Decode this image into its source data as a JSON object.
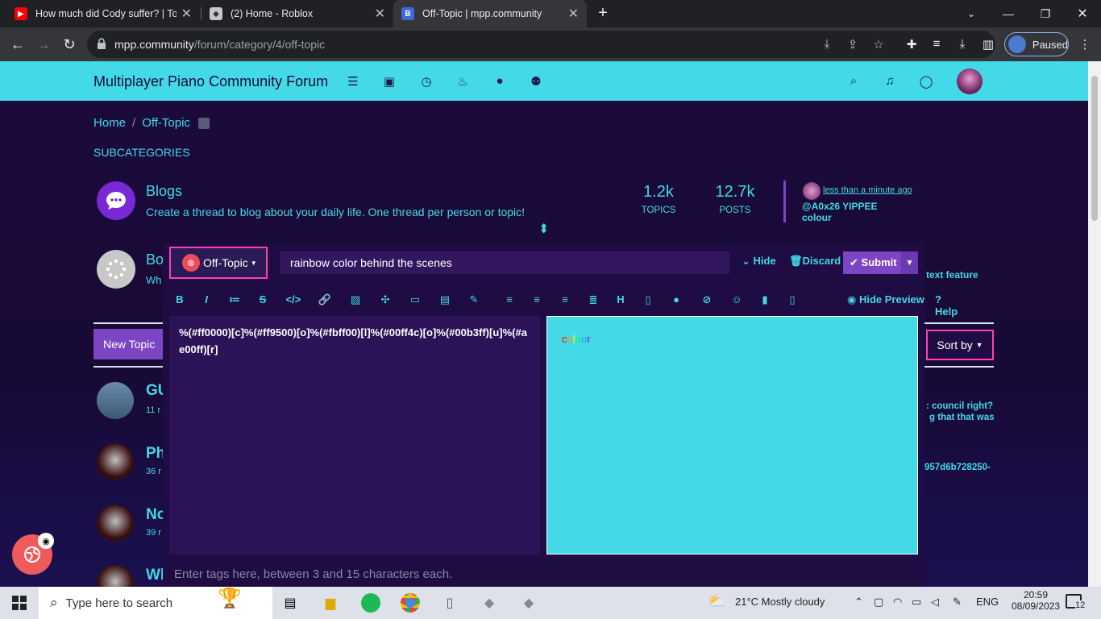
{
  "browser": {
    "tabs": [
      {
        "title": "How much did Cody suffer? | Tota",
        "icon": "youtube-icon"
      },
      {
        "title": "(2) Home - Roblox",
        "icon": "roblox-icon"
      },
      {
        "title": "Off-Topic | mpp.community",
        "icon": "b-icon"
      }
    ],
    "url_domain": "mpp.community",
    "url_path": "/forum/category/4/off-topic",
    "profile_status": "Paused"
  },
  "forum": {
    "brand": "Multiplayer Piano Community Forum",
    "breadcrumb": {
      "home": "Home",
      "current": "Off-Topic"
    },
    "subcategories_label": "SUBCATEGORIES",
    "category": {
      "name": "Blogs",
      "description": "Create a thread to blog about your daily life. One thread per person or topic!",
      "topics_count": "1.2k",
      "topics_label": "TOPICS",
      "posts_count": "12.7k",
      "posts_label": "POSTS",
      "last_post_time": "less than a minute ago",
      "last_post_title": "@A0x26 YIPPEE",
      "last_post_excerpt": "colour"
    },
    "category2": {
      "name_fragment": "Bo",
      "desc_fragment": "Wh",
      "right_fragment": "text feature"
    },
    "new_topic_label": "New Topic",
    "sort_label": "Sort by",
    "topics": [
      {
        "title_fragment": "GU",
        "meta_fragment": "11 r",
        "right_line1": ": council right?",
        "right_line2": "g that that was"
      },
      {
        "title_fragment": "Ph",
        "meta_fragment": "36 r",
        "right_line1": "957d6b728250-"
      },
      {
        "title_fragment": "No",
        "meta_fragment": "39 r"
      },
      {
        "title_fragment": "Wh"
      }
    ]
  },
  "composer": {
    "category_label": "Off-Topic",
    "title_value": "rainbow color behind the scenes",
    "hide_label": "Hide",
    "discard_label": "Discard",
    "submit_label": "Submit",
    "hide_preview_label": "Hide Preview",
    "help_label": "Help",
    "editor_text": "%(#ff0000)[c]%(#ff9500)[o]%(#fbff00)[l]%(#00ff4c)[o]%(#00b3ff)[u]%(#ae00ff)[r]",
    "preview_letters": [
      {
        "ch": "c",
        "color": "#ff0000"
      },
      {
        "ch": "o",
        "color": "#ff9500"
      },
      {
        "ch": "l",
        "color": "#fbff00"
      },
      {
        "ch": "o",
        "color": "#00ff4c"
      },
      {
        "ch": "u",
        "color": "#00b3ff"
      },
      {
        "ch": "r",
        "color": "#ae00ff"
      }
    ],
    "tags_placeholder": "Enter tags here, between 3 and 15 characters each."
  },
  "taskbar": {
    "search_placeholder": "Type here to search",
    "weather": "21°C  Mostly cloudy",
    "language": "ENG",
    "time": "20:59",
    "date": "08/09/2023",
    "notifications": "12"
  },
  "colors": {
    "accent": "#43d9e6",
    "highlight": "#ff3fb3",
    "background": "#1a0b3b",
    "submit": "#7b45c4"
  }
}
